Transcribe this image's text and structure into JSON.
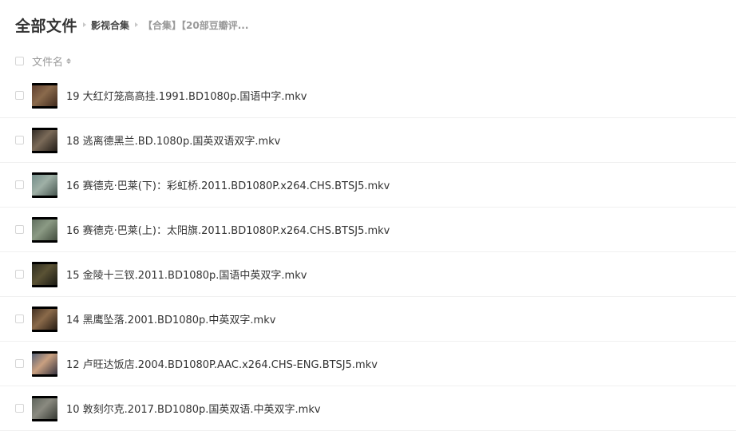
{
  "breadcrumb": {
    "root": "全部文件",
    "folder": "影视合集",
    "current": "【合集】【20部豆瓣评..."
  },
  "list_header": {
    "column_name": "文件名"
  },
  "files": [
    {
      "name": "19 大红灯笼高高挂.1991.BD1080p.国语中字.mkv",
      "thumb_colors": [
        "#5a3b2c",
        "#8a6a4c",
        "#3a2418"
      ]
    },
    {
      "name": "18 逃离德黑兰.BD.1080p.国英双语双字.mkv",
      "thumb_colors": [
        "#2b2622",
        "#7a6a58",
        "#1a1612"
      ]
    },
    {
      "name": "16 赛德克·巴莱(下)：彩虹桥.2011.BD1080P.x264.CHS.BTSJ5.mkv",
      "thumb_colors": [
        "#6f8a86",
        "#9fb0a6",
        "#3f4e48"
      ]
    },
    {
      "name": "16 赛德克·巴莱(上)：太阳旗.2011.BD1080P.x264.CHS.BTSJ5.mkv",
      "thumb_colors": [
        "#5d6b5c",
        "#8b9a84",
        "#3c4638"
      ]
    },
    {
      "name": "15 金陵十三钗.2011.BD1080p.国语中英双字.mkv",
      "thumb_colors": [
        "#2a2a1e",
        "#5a5234",
        "#151510"
      ]
    },
    {
      "name": "14 黑鹰坠落.2001.BD1080p.中英双字.mkv",
      "thumb_colors": [
        "#3a2a1e",
        "#8a6a4a",
        "#1c140e"
      ]
    },
    {
      "name": "12 卢旺达饭店.2004.BD1080P.AAC.x264.CHS-ENG.BTSJ5.mkv",
      "thumb_colors": [
        "#4a5a74",
        "#c9a080",
        "#2a2a3a"
      ]
    },
    {
      "name": "10 敦刻尔克.2017.BD1080p.国英双语.中英双字.mkv",
      "thumb_colors": [
        "#5a6058",
        "#8a8a80",
        "#2e322c"
      ]
    }
  ]
}
